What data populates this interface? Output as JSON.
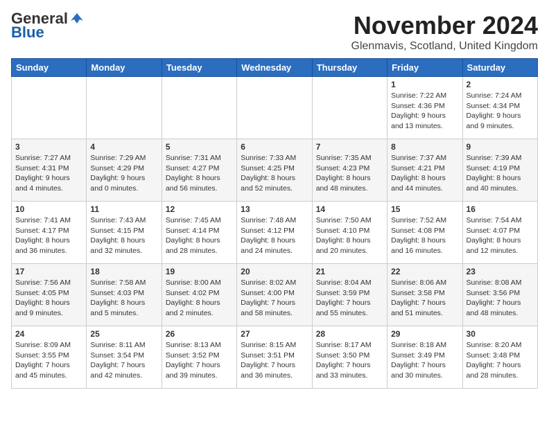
{
  "header": {
    "logo_general": "General",
    "logo_blue": "Blue",
    "month_title": "November 2024",
    "location": "Glenmavis, Scotland, United Kingdom"
  },
  "days_of_week": [
    "Sunday",
    "Monday",
    "Tuesday",
    "Wednesday",
    "Thursday",
    "Friday",
    "Saturday"
  ],
  "weeks": [
    [
      {
        "day": "",
        "info": ""
      },
      {
        "day": "",
        "info": ""
      },
      {
        "day": "",
        "info": ""
      },
      {
        "day": "",
        "info": ""
      },
      {
        "day": "",
        "info": ""
      },
      {
        "day": "1",
        "info": "Sunrise: 7:22 AM\nSunset: 4:36 PM\nDaylight: 9 hours and 13 minutes."
      },
      {
        "day": "2",
        "info": "Sunrise: 7:24 AM\nSunset: 4:34 PM\nDaylight: 9 hours and 9 minutes."
      }
    ],
    [
      {
        "day": "3",
        "info": "Sunrise: 7:27 AM\nSunset: 4:31 PM\nDaylight: 9 hours and 4 minutes."
      },
      {
        "day": "4",
        "info": "Sunrise: 7:29 AM\nSunset: 4:29 PM\nDaylight: 9 hours and 0 minutes."
      },
      {
        "day": "5",
        "info": "Sunrise: 7:31 AM\nSunset: 4:27 PM\nDaylight: 8 hours and 56 minutes."
      },
      {
        "day": "6",
        "info": "Sunrise: 7:33 AM\nSunset: 4:25 PM\nDaylight: 8 hours and 52 minutes."
      },
      {
        "day": "7",
        "info": "Sunrise: 7:35 AM\nSunset: 4:23 PM\nDaylight: 8 hours and 48 minutes."
      },
      {
        "day": "8",
        "info": "Sunrise: 7:37 AM\nSunset: 4:21 PM\nDaylight: 8 hours and 44 minutes."
      },
      {
        "day": "9",
        "info": "Sunrise: 7:39 AM\nSunset: 4:19 PM\nDaylight: 8 hours and 40 minutes."
      }
    ],
    [
      {
        "day": "10",
        "info": "Sunrise: 7:41 AM\nSunset: 4:17 PM\nDaylight: 8 hours and 36 minutes."
      },
      {
        "day": "11",
        "info": "Sunrise: 7:43 AM\nSunset: 4:15 PM\nDaylight: 8 hours and 32 minutes."
      },
      {
        "day": "12",
        "info": "Sunrise: 7:45 AM\nSunset: 4:14 PM\nDaylight: 8 hours and 28 minutes."
      },
      {
        "day": "13",
        "info": "Sunrise: 7:48 AM\nSunset: 4:12 PM\nDaylight: 8 hours and 24 minutes."
      },
      {
        "day": "14",
        "info": "Sunrise: 7:50 AM\nSunset: 4:10 PM\nDaylight: 8 hours and 20 minutes."
      },
      {
        "day": "15",
        "info": "Sunrise: 7:52 AM\nSunset: 4:08 PM\nDaylight: 8 hours and 16 minutes."
      },
      {
        "day": "16",
        "info": "Sunrise: 7:54 AM\nSunset: 4:07 PM\nDaylight: 8 hours and 12 minutes."
      }
    ],
    [
      {
        "day": "17",
        "info": "Sunrise: 7:56 AM\nSunset: 4:05 PM\nDaylight: 8 hours and 9 minutes."
      },
      {
        "day": "18",
        "info": "Sunrise: 7:58 AM\nSunset: 4:03 PM\nDaylight: 8 hours and 5 minutes."
      },
      {
        "day": "19",
        "info": "Sunrise: 8:00 AM\nSunset: 4:02 PM\nDaylight: 8 hours and 2 minutes."
      },
      {
        "day": "20",
        "info": "Sunrise: 8:02 AM\nSunset: 4:00 PM\nDaylight: 7 hours and 58 minutes."
      },
      {
        "day": "21",
        "info": "Sunrise: 8:04 AM\nSunset: 3:59 PM\nDaylight: 7 hours and 55 minutes."
      },
      {
        "day": "22",
        "info": "Sunrise: 8:06 AM\nSunset: 3:58 PM\nDaylight: 7 hours and 51 minutes."
      },
      {
        "day": "23",
        "info": "Sunrise: 8:08 AM\nSunset: 3:56 PM\nDaylight: 7 hours and 48 minutes."
      }
    ],
    [
      {
        "day": "24",
        "info": "Sunrise: 8:09 AM\nSunset: 3:55 PM\nDaylight: 7 hours and 45 minutes."
      },
      {
        "day": "25",
        "info": "Sunrise: 8:11 AM\nSunset: 3:54 PM\nDaylight: 7 hours and 42 minutes."
      },
      {
        "day": "26",
        "info": "Sunrise: 8:13 AM\nSunset: 3:52 PM\nDaylight: 7 hours and 39 minutes."
      },
      {
        "day": "27",
        "info": "Sunrise: 8:15 AM\nSunset: 3:51 PM\nDaylight: 7 hours and 36 minutes."
      },
      {
        "day": "28",
        "info": "Sunrise: 8:17 AM\nSunset: 3:50 PM\nDaylight: 7 hours and 33 minutes."
      },
      {
        "day": "29",
        "info": "Sunrise: 8:18 AM\nSunset: 3:49 PM\nDaylight: 7 hours and 30 minutes."
      },
      {
        "day": "30",
        "info": "Sunrise: 8:20 AM\nSunset: 3:48 PM\nDaylight: 7 hours and 28 minutes."
      }
    ]
  ]
}
